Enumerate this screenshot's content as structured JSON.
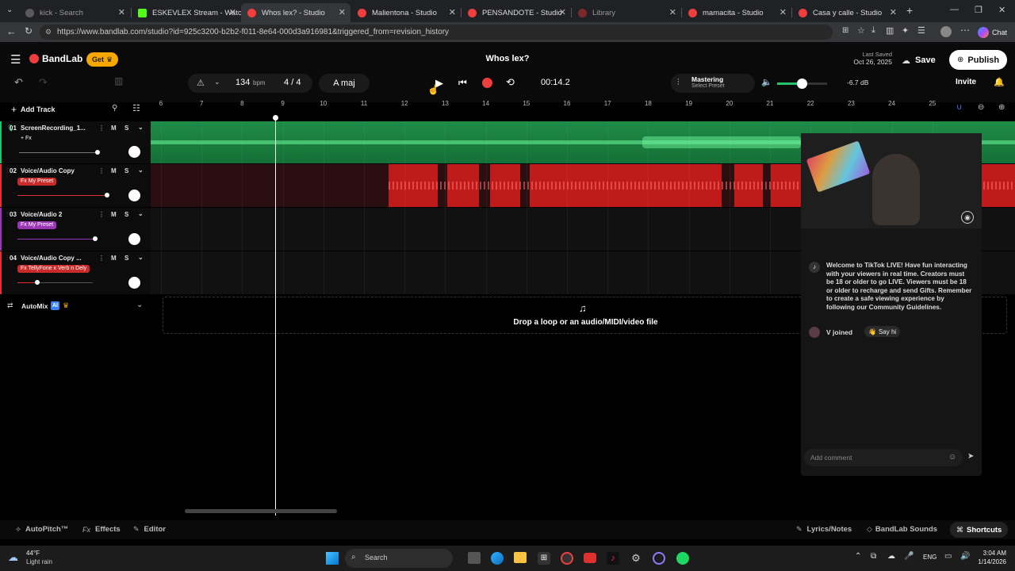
{
  "browser": {
    "tabs": [
      {
        "label": "kick - Search",
        "active": false,
        "color": "#5a5a5a"
      },
      {
        "label": "ESKEVLEX Stream - Watch Li",
        "active": false,
        "color": "#53fc18"
      },
      {
        "label": "Whos lex? - Studio",
        "active": true,
        "color": "#f03e3e"
      },
      {
        "label": "Malientona - Studio",
        "active": false,
        "color": "#f03e3e"
      },
      {
        "label": "PENSANDOTE - Studio",
        "active": false,
        "color": "#f03e3e"
      },
      {
        "label": "Library",
        "active": false,
        "color": "#f03e3e"
      },
      {
        "label": "mamacita - Studio",
        "active": false,
        "color": "#f03e3e"
      },
      {
        "label": "Casa y calle - Studio",
        "active": false,
        "color": "#f03e3e"
      }
    ],
    "url": "https://www.bandlab.com/studio?id=925c3200-b2b2-f011-8e64-000d3a916981&triggered_from=revision_history",
    "chat_label": "Chat"
  },
  "app": {
    "brand": "BandLab",
    "get_label": "Get",
    "project_title": "Whos lex?",
    "last_saved_label": "Last Saved",
    "last_saved_date": "Oct 26, 2025",
    "save_label": "Save",
    "publish_label": "Publish",
    "invite_label": "Invite",
    "tempo": "134",
    "tempo_unit": "bpm",
    "time_sig_num": "4",
    "time_sig_sep": "/",
    "time_sig_den": "4",
    "key": "A maj",
    "time": "00:14.2",
    "mastering_label": "Mastering",
    "mastering_preset": "Select Preset",
    "volume_db": "-6.7 dB",
    "add_track_label": "Add Track",
    "ruler": [
      "6",
      "7",
      "8",
      "9",
      "10",
      "11",
      "12",
      "13",
      "14",
      "15",
      "16",
      "17",
      "18",
      "19",
      "20",
      "21",
      "22",
      "23",
      "24",
      "25"
    ],
    "tracks": [
      {
        "num": "01",
        "name": "ScreenRecording_1...",
        "fx": "+ Fx",
        "fx_color": "#0c0c0c",
        "lane_color": "#0f3a1e"
      },
      {
        "num": "02",
        "name": "Voice/Audio Copy",
        "fx": "Fx My Preset",
        "fx_color": "#c92a2a",
        "lane_color": "#2a0e0e"
      },
      {
        "num": "03",
        "name": "Voice/Audio 2",
        "fx": "Fx My Preset",
        "fx_color": "#9c36b5",
        "lane_color": "#111"
      },
      {
        "num": "04",
        "name": "Voice/Audio Copy ...",
        "fx": "Fx TellyFone x Verb n Dely",
        "fx_color": "#c92a2a",
        "lane_color": "#111"
      }
    ],
    "m_label": "M",
    "s_label": "S",
    "automix_label": "AutoMix",
    "ai_label": "AI",
    "drop_text": "Drop a loop or an audio/MIDI/video file",
    "bottom": {
      "autopitch": "AutoPitch™",
      "effects": "Effects",
      "editor": "Editor",
      "lyrics": "Lyrics/Notes",
      "sounds": "BandLab Sounds",
      "shortcuts": "Shortcuts"
    }
  },
  "live": {
    "welcome": "Welcome to TikTok LIVE! Have fun interacting with your viewers in real time. Creators must be 18 or older to go LIVE. Viewers must be 18 or older to recharge and send Gifts. Remember to create a safe viewing experience by following our Community Guidelines.",
    "joined_user": "V",
    "joined_text": "joined",
    "say_hi": "Say hi",
    "comment_placeholder": "Add comment"
  },
  "taskbar": {
    "temp": "44°F",
    "weather": "Light rain",
    "search": "Search",
    "lang": "ENG",
    "time": "3:04 AM",
    "date": "1/14/2026"
  }
}
